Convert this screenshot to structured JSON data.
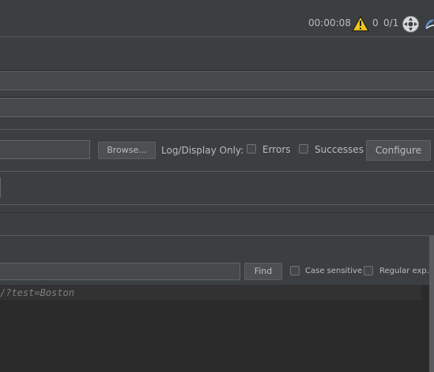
{
  "toolbar": {
    "timer": "00:00:08",
    "warning_count": "0",
    "threads": "0/1",
    "icons": [
      "warning-icon",
      "remote-icon",
      "extra-icon"
    ]
  },
  "file_row": {
    "browse_label": "Browse...",
    "log_display_label": "Log/Display Only:",
    "errors_label": "Errors",
    "successes_label": "Successes",
    "configure_label": "Configure"
  },
  "search": {
    "find_label": "Find",
    "case_sensitive_label": "Case sensitive",
    "regex_label": "Regular exp."
  },
  "results": {
    "first_row": "/?test=Boston"
  },
  "colors": {
    "background": "#3c3f41",
    "results_bg": "#2b2b2b",
    "warning": "#f0c419"
  }
}
